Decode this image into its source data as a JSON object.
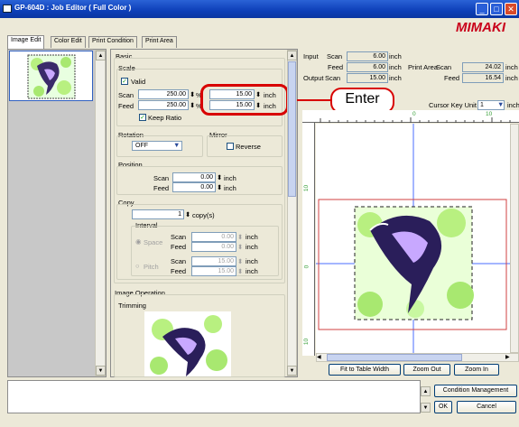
{
  "window": {
    "title": "GP-604D : Job Editor ( Full Color )",
    "logo": "MIMAKI"
  },
  "tabs": [
    {
      "label": "Image Edit"
    },
    {
      "label": "Color Edit"
    },
    {
      "label": "Print Condition"
    },
    {
      "label": "Print Area"
    }
  ],
  "basic": {
    "title": "Basic",
    "scale_title": "Scale",
    "valid": "Valid",
    "scan_label": "Scan",
    "feed_label": "Feed",
    "scan_pct": "250.00",
    "feed_pct": "250.00",
    "pct": "%",
    "scan_inch": "15.00",
    "feed_inch": "15.00",
    "inch": "inch",
    "keep_ratio": "Keep Ratio",
    "rotation_title": "Rotation",
    "rotation_value": "OFF",
    "mirror_title": "Mirror",
    "reverse": "Reverse",
    "position_title": "Position",
    "pos_scan": "0.00",
    "pos_feed": "0.00",
    "copy_title": "Copy",
    "copies": "1",
    "copies_unit": "copy(s)",
    "interval_title": "Interval",
    "space": "Space",
    "space_scan": "0.00",
    "space_feed": "0.00",
    "pitch": "Pitch",
    "pitch_scan": "15.00",
    "pitch_feed": "15.00"
  },
  "image_operation": {
    "title": "Image Operation",
    "trimming": "Trimming"
  },
  "info": {
    "input": "Input",
    "output": "Output",
    "scan": "Scan",
    "feed": "Feed",
    "inch": "inch",
    "input_scan": "6.00",
    "input_feed": "6.00",
    "output_scan": "15.00",
    "output_feed": "15.00",
    "print_area": "Print Area",
    "pa_scan": "24.02",
    "pa_feed": "16.54",
    "cursor_key_unit": "Cursor Key Unit",
    "cursor_value": "1",
    "cursor_unit": "inch"
  },
  "ruler": {
    "top": [
      "0",
      "10"
    ],
    "left": [
      "10",
      "0",
      "10"
    ]
  },
  "callout": {
    "text": "Enter"
  },
  "buttons": {
    "fit": "Fit to Table Width",
    "zoom_out": "Zoom Out",
    "zoom_in": "Zoom In",
    "condition": "Condition Management",
    "ok": "OK",
    "cancel": "Cancel"
  },
  "colors": {
    "titlebar": "#0d3fb8",
    "callout_red": "#d80000",
    "logo_red": "#c9001a",
    "guide_blue": "#4a6cff"
  }
}
